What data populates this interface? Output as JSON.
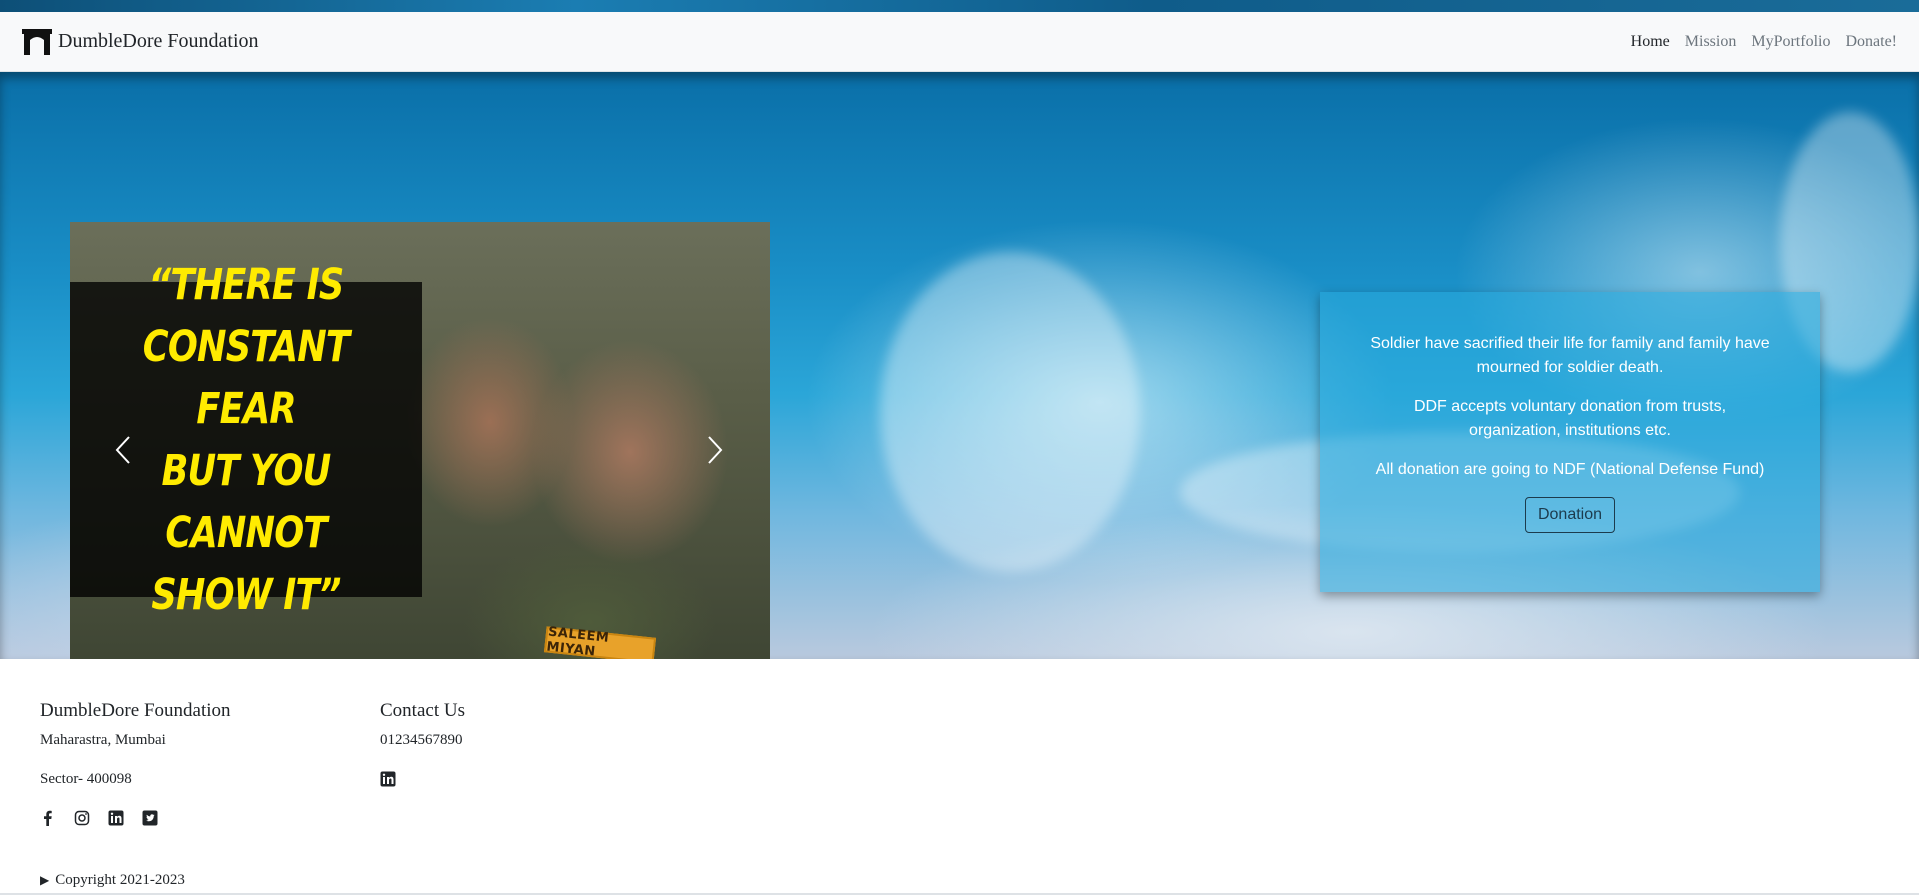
{
  "navbar": {
    "brand": "DumbleDore Foundation",
    "links": [
      {
        "label": "Home",
        "active": true
      },
      {
        "label": "Mission",
        "active": false
      },
      {
        "label": "MyPortfolio",
        "active": false
      },
      {
        "label": "Donate!",
        "active": false
      }
    ]
  },
  "carousel": {
    "quote": "“THERE IS\nCONSTANT FEAR\nBUT YOU CANNOT\nSHOW IT”",
    "badge": "SALEEM MIYAN",
    "controls": {
      "prev": "prev-chevron-icon",
      "next": "next-chevron-icon"
    }
  },
  "info_card": {
    "paragraphs": [
      "Soldier have sacrified their life for family and family have mourned for soldier death.",
      "DDF accepts voluntary donation from trusts, organization, institutions etc.",
      "All donation are going to NDF (National Defense Fund)"
    ],
    "button": "Donation"
  },
  "footer": {
    "left": {
      "heading": "DumbleDore Foundation",
      "address_line1": "Maharastra, Mumbai",
      "address_line2": "Sector- 400098",
      "social": [
        "facebook-icon",
        "instagram-icon",
        "linkedin-icon",
        "twitter-icon"
      ]
    },
    "right": {
      "heading": "Contact Us",
      "phone": "01234567890",
      "social": [
        "linkedin-icon"
      ]
    },
    "copyright": "Copyright 2021-2023"
  },
  "colors": {
    "navbar_bg": "#f8f9fa",
    "quote_yellow": "#ffeb00",
    "card_bg": "#28aadc",
    "button_border": "#1c3b4d"
  }
}
